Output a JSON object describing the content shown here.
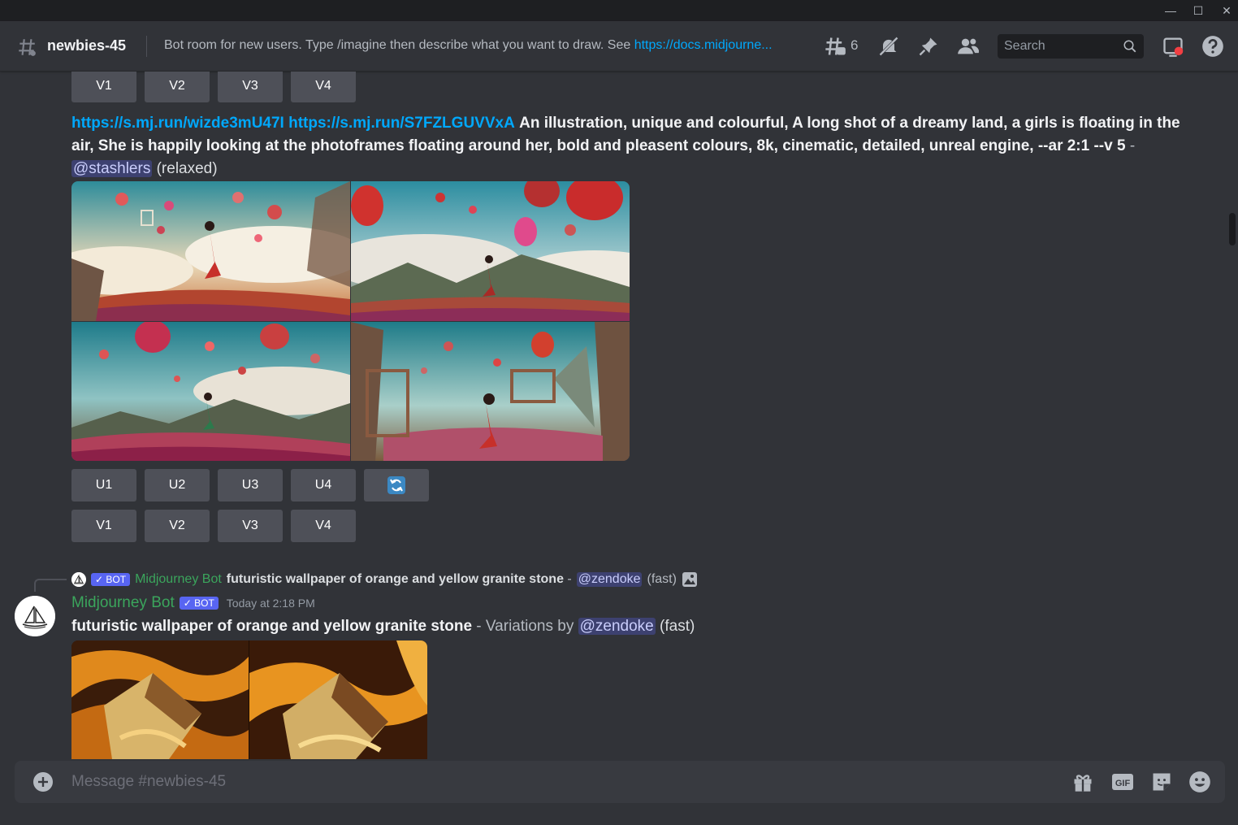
{
  "window": {
    "controls": [
      "—",
      "☐",
      "✕"
    ]
  },
  "header": {
    "channel_name": "newbies-45",
    "topic_prefix": "Bot room for new users. Type /imagine then describe what you want to draw. See ",
    "topic_link": "https://docs.midjourne...",
    "threads_count": "6",
    "search_placeholder": "Search",
    "icons": [
      "threads-icon",
      "mute-notifications-icon",
      "pin-icon",
      "member-list-icon",
      "search-icon",
      "inbox-icon",
      "help-icon"
    ]
  },
  "top_buttons": [
    "V1",
    "V2",
    "V3",
    "V4"
  ],
  "message1": {
    "link1": "https://s.mj.run/wizde3mU47I",
    "link2": "https://s.mj.run/S7FZLGUVVxA",
    "prompt": "An illustration, unique and colourful, A long shot of a dreamy land, a girls is floating in the air, She is happily looking at the photoframes floating around her, bold and pleasent colours, 8k, cinematic, detailed, unreal engine, --ar 2:1 --v 5",
    "dash": " - ",
    "mention": "@stashlers",
    "mode": "(relaxed)",
    "upscale_buttons": [
      "U1",
      "U2",
      "U3",
      "U4"
    ],
    "variation_buttons": [
      "V1",
      "V2",
      "V3",
      "V4"
    ]
  },
  "reply": {
    "bot_tag": "✓ BOT",
    "author": "Midjourney Bot",
    "text": "futuristic wallpaper of orange and yellow granite stone",
    "dash": " - ",
    "mention": "@zendoke",
    "mode": "(fast)"
  },
  "message2": {
    "author": "Midjourney Bot",
    "bot_tag": "✓ BOT",
    "timestamp": "Today at 2:18 PM",
    "prompt": "futuristic wallpaper of orange and yellow granite stone",
    "suffix": " - Variations by ",
    "mention": "@zendoke",
    "mode": "(fast)"
  },
  "composer": {
    "placeholder": "Message #newbies-45",
    "icons": [
      "add-attachment-icon",
      "gift-icon",
      "gif-icon",
      "sticker-icon",
      "emoji-icon"
    ]
  },
  "colors": {
    "background": "#313338",
    "link": "#00a8fc",
    "bot_badge": "#5865f2",
    "bot_name": "#3ba55c",
    "button": "#4e5058"
  }
}
